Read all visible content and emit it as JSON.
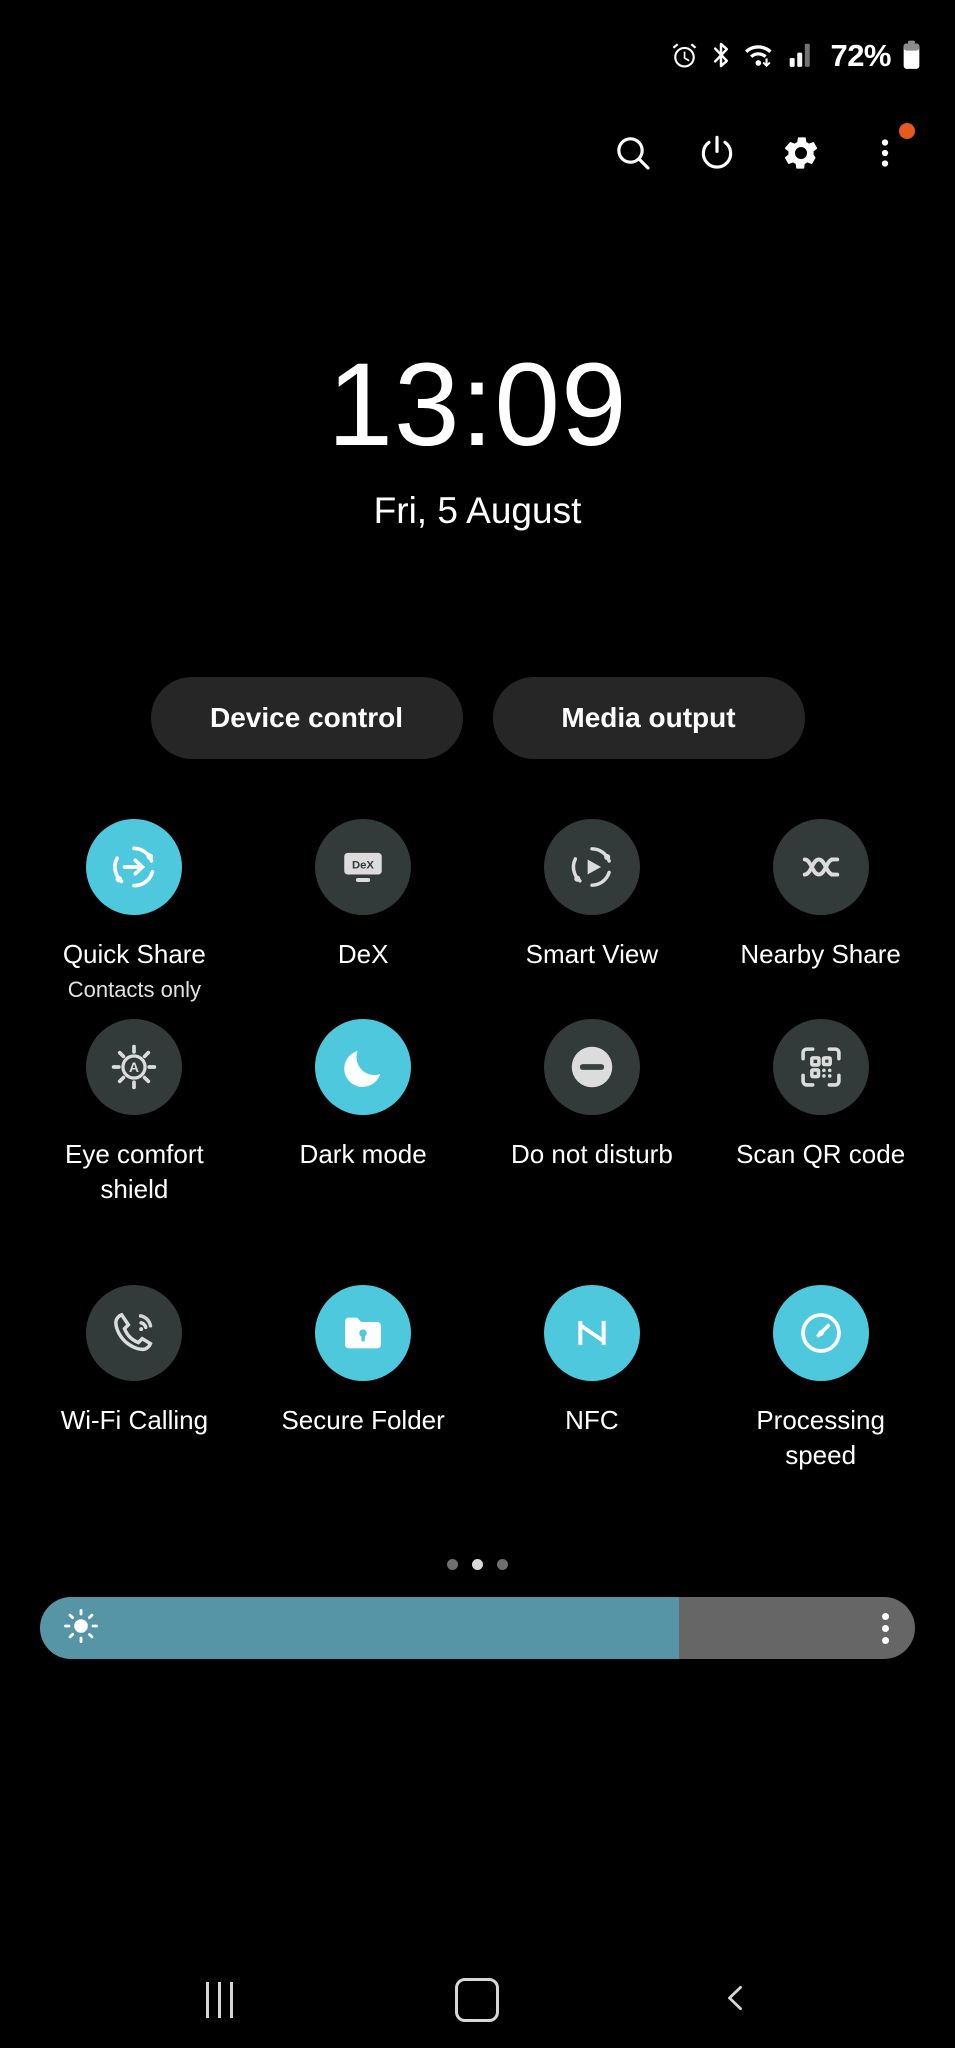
{
  "status_bar": {
    "icons": [
      "alarm-icon",
      "bluetooth-icon",
      "wifi-icon",
      "signal-icon"
    ],
    "battery_percent": "72%",
    "battery_icon": "battery-icon"
  },
  "toolbar": {
    "buttons": [
      {
        "name": "search-button",
        "icon": "search-icon"
      },
      {
        "name": "power-button",
        "icon": "power-icon"
      },
      {
        "name": "settings-button",
        "icon": "gear-icon"
      },
      {
        "name": "more-options-button",
        "icon": "overflow-menu-icon",
        "badge": true
      }
    ],
    "badge_color": "#e8591f"
  },
  "clock": {
    "time": "13:09",
    "date": "Fri, 5 August"
  },
  "quick_actions": {
    "device_control": "Device control",
    "media_output": "Media output"
  },
  "tiles": [
    {
      "label": "Quick Share",
      "sub": "Contacts only",
      "icon": "quick-share-icon",
      "active": true
    },
    {
      "label": "DeX",
      "sub": "",
      "icon": "dex-icon",
      "active": false
    },
    {
      "label": "Smart View",
      "sub": "",
      "icon": "smart-view-icon",
      "active": false
    },
    {
      "label": "Nearby Share",
      "sub": "",
      "icon": "nearby-share-icon",
      "active": false
    },
    {
      "label": "Eye comfort shield",
      "sub": "",
      "icon": "eye-comfort-shield-icon",
      "active": false
    },
    {
      "label": "Dark mode",
      "sub": "",
      "icon": "moon-icon",
      "active": true
    },
    {
      "label": "Do not disturb",
      "sub": "",
      "icon": "do-not-disturb-icon",
      "active": false
    },
    {
      "label": "Scan QR code",
      "sub": "",
      "icon": "qr-code-icon",
      "active": false
    },
    {
      "label": "Wi-Fi Calling",
      "sub": "",
      "icon": "wifi-calling-icon",
      "active": false
    },
    {
      "label": "Secure Folder",
      "sub": "",
      "icon": "secure-folder-icon",
      "active": true
    },
    {
      "label": "NFC",
      "sub": "",
      "icon": "nfc-icon",
      "active": true
    },
    {
      "label": "Processing speed",
      "sub": "",
      "icon": "processing-speed-icon",
      "active": true
    }
  ],
  "pagination": {
    "total": 3,
    "current": 2
  },
  "brightness": {
    "value_percent": 73,
    "icon": "brightness-sun-icon",
    "menu_icon": "overflow-menu-icon"
  },
  "nav_bar": {
    "recents": "recents-icon",
    "home": "home-icon",
    "back": "back-icon"
  },
  "colors": {
    "accent": "#4ec8dd",
    "tile_off": "#333a3a",
    "pill_bg": "#262626",
    "slider_fill": "#5695a5",
    "slider_track": "#666666",
    "background": "#000000",
    "badge": "#e8591f"
  }
}
